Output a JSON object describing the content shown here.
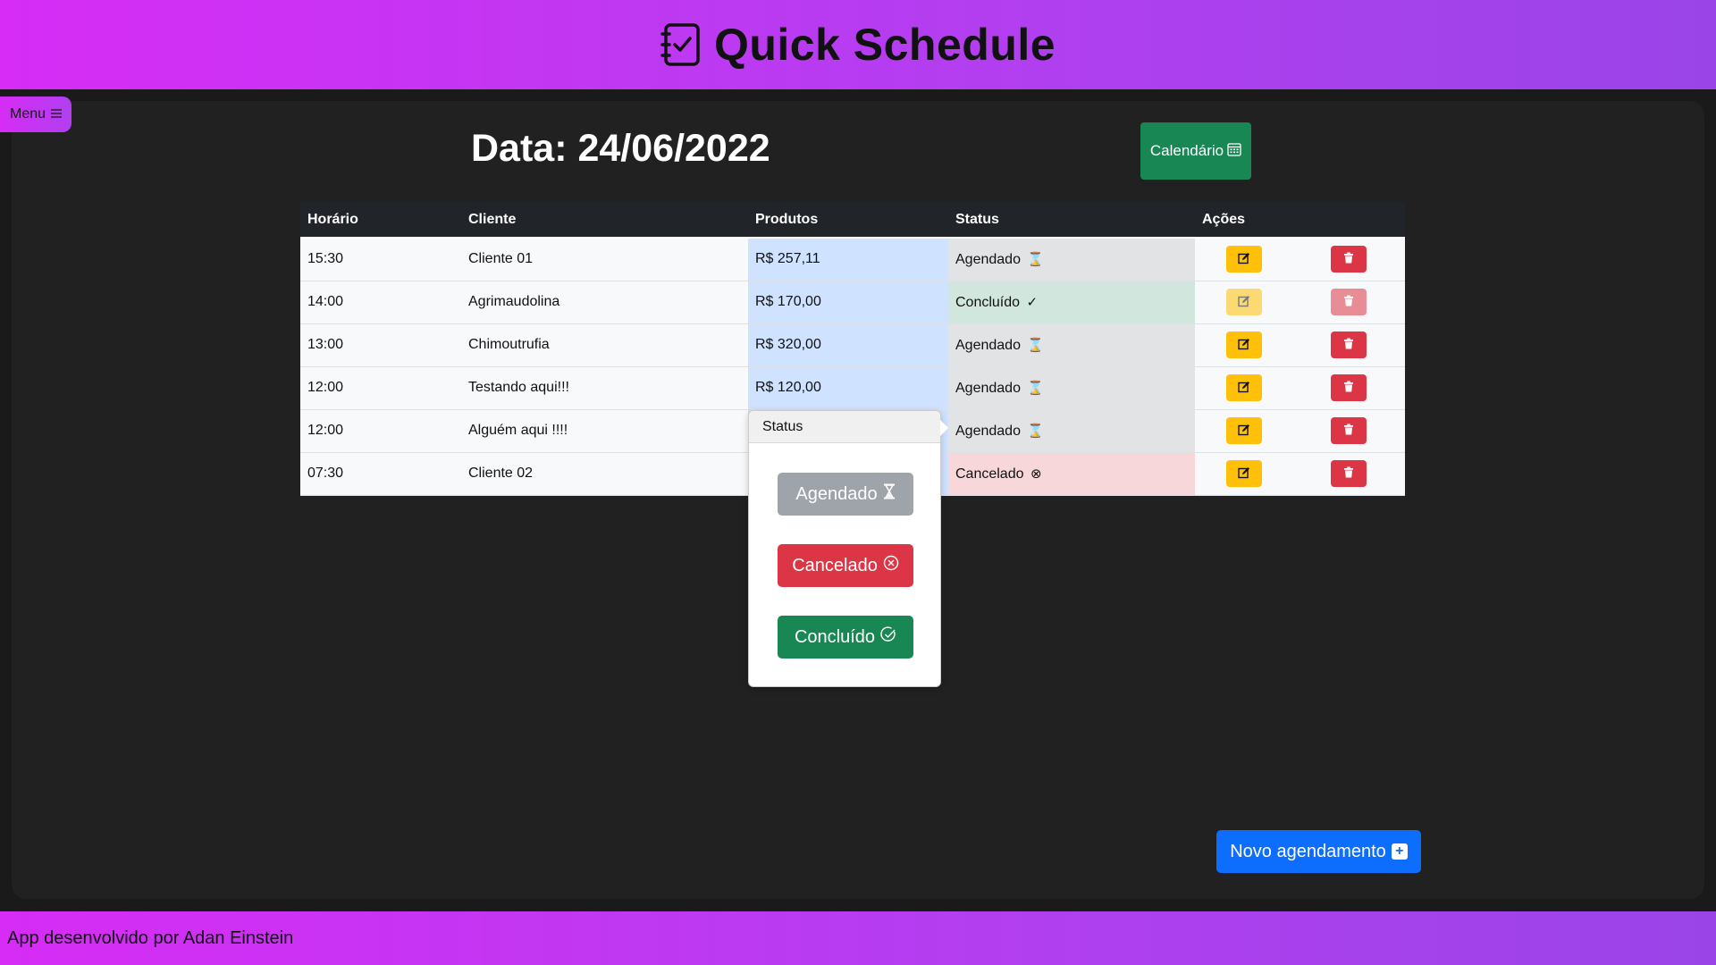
{
  "header": {
    "title": "Quick Schedule",
    "icon": "checklist-notebook-icon"
  },
  "menu": {
    "label": "Menu",
    "icon": "hamburger-icon"
  },
  "page": {
    "date_title": "Data: 24/06/2022",
    "calendar_button": "Calendário",
    "new_button": "Novo agendamento"
  },
  "table": {
    "columns": [
      "Horário",
      "Cliente",
      "Produtos",
      "Status",
      "Ações"
    ],
    "rows": [
      {
        "time": "15:30",
        "client": "Cliente 01",
        "products": "R$ 257,11",
        "status": "Agendado",
        "status_glyph": "⌛"
      },
      {
        "time": "14:00",
        "client": "Agrimaudolina",
        "products": "R$ 170,00",
        "status": "Concluído",
        "status_glyph": "✓"
      },
      {
        "time": "13:00",
        "client": "Chimoutrufia",
        "products": "R$ 320,00",
        "status": "Agendado",
        "status_glyph": "⌛"
      },
      {
        "time": "12:00",
        "client": "Testando aqui!!!",
        "products": "R$ 120,00",
        "status": "Agendado",
        "status_glyph": "⌛"
      },
      {
        "time": "12:00",
        "client": "Alguém aqui !!!!",
        "products": "",
        "status": "Agendado",
        "status_glyph": "⌛"
      },
      {
        "time": "07:30",
        "client": "Cliente 02",
        "products": "",
        "status": "Cancelado",
        "status_glyph": "⊗"
      }
    ]
  },
  "popover": {
    "title": "Status",
    "options": [
      "Agendado",
      "Cancelado",
      "Concluído"
    ]
  },
  "footer": {
    "text": "App desenvolvido por Adan Einstein"
  },
  "colors": {
    "gradient_start": "#d62cf5",
    "gradient_end": "#9a44e8",
    "success": "#198754",
    "warning": "#ffc107",
    "danger": "#dc3545",
    "primary": "#0d6efd",
    "secondary": "#6c757d"
  }
}
